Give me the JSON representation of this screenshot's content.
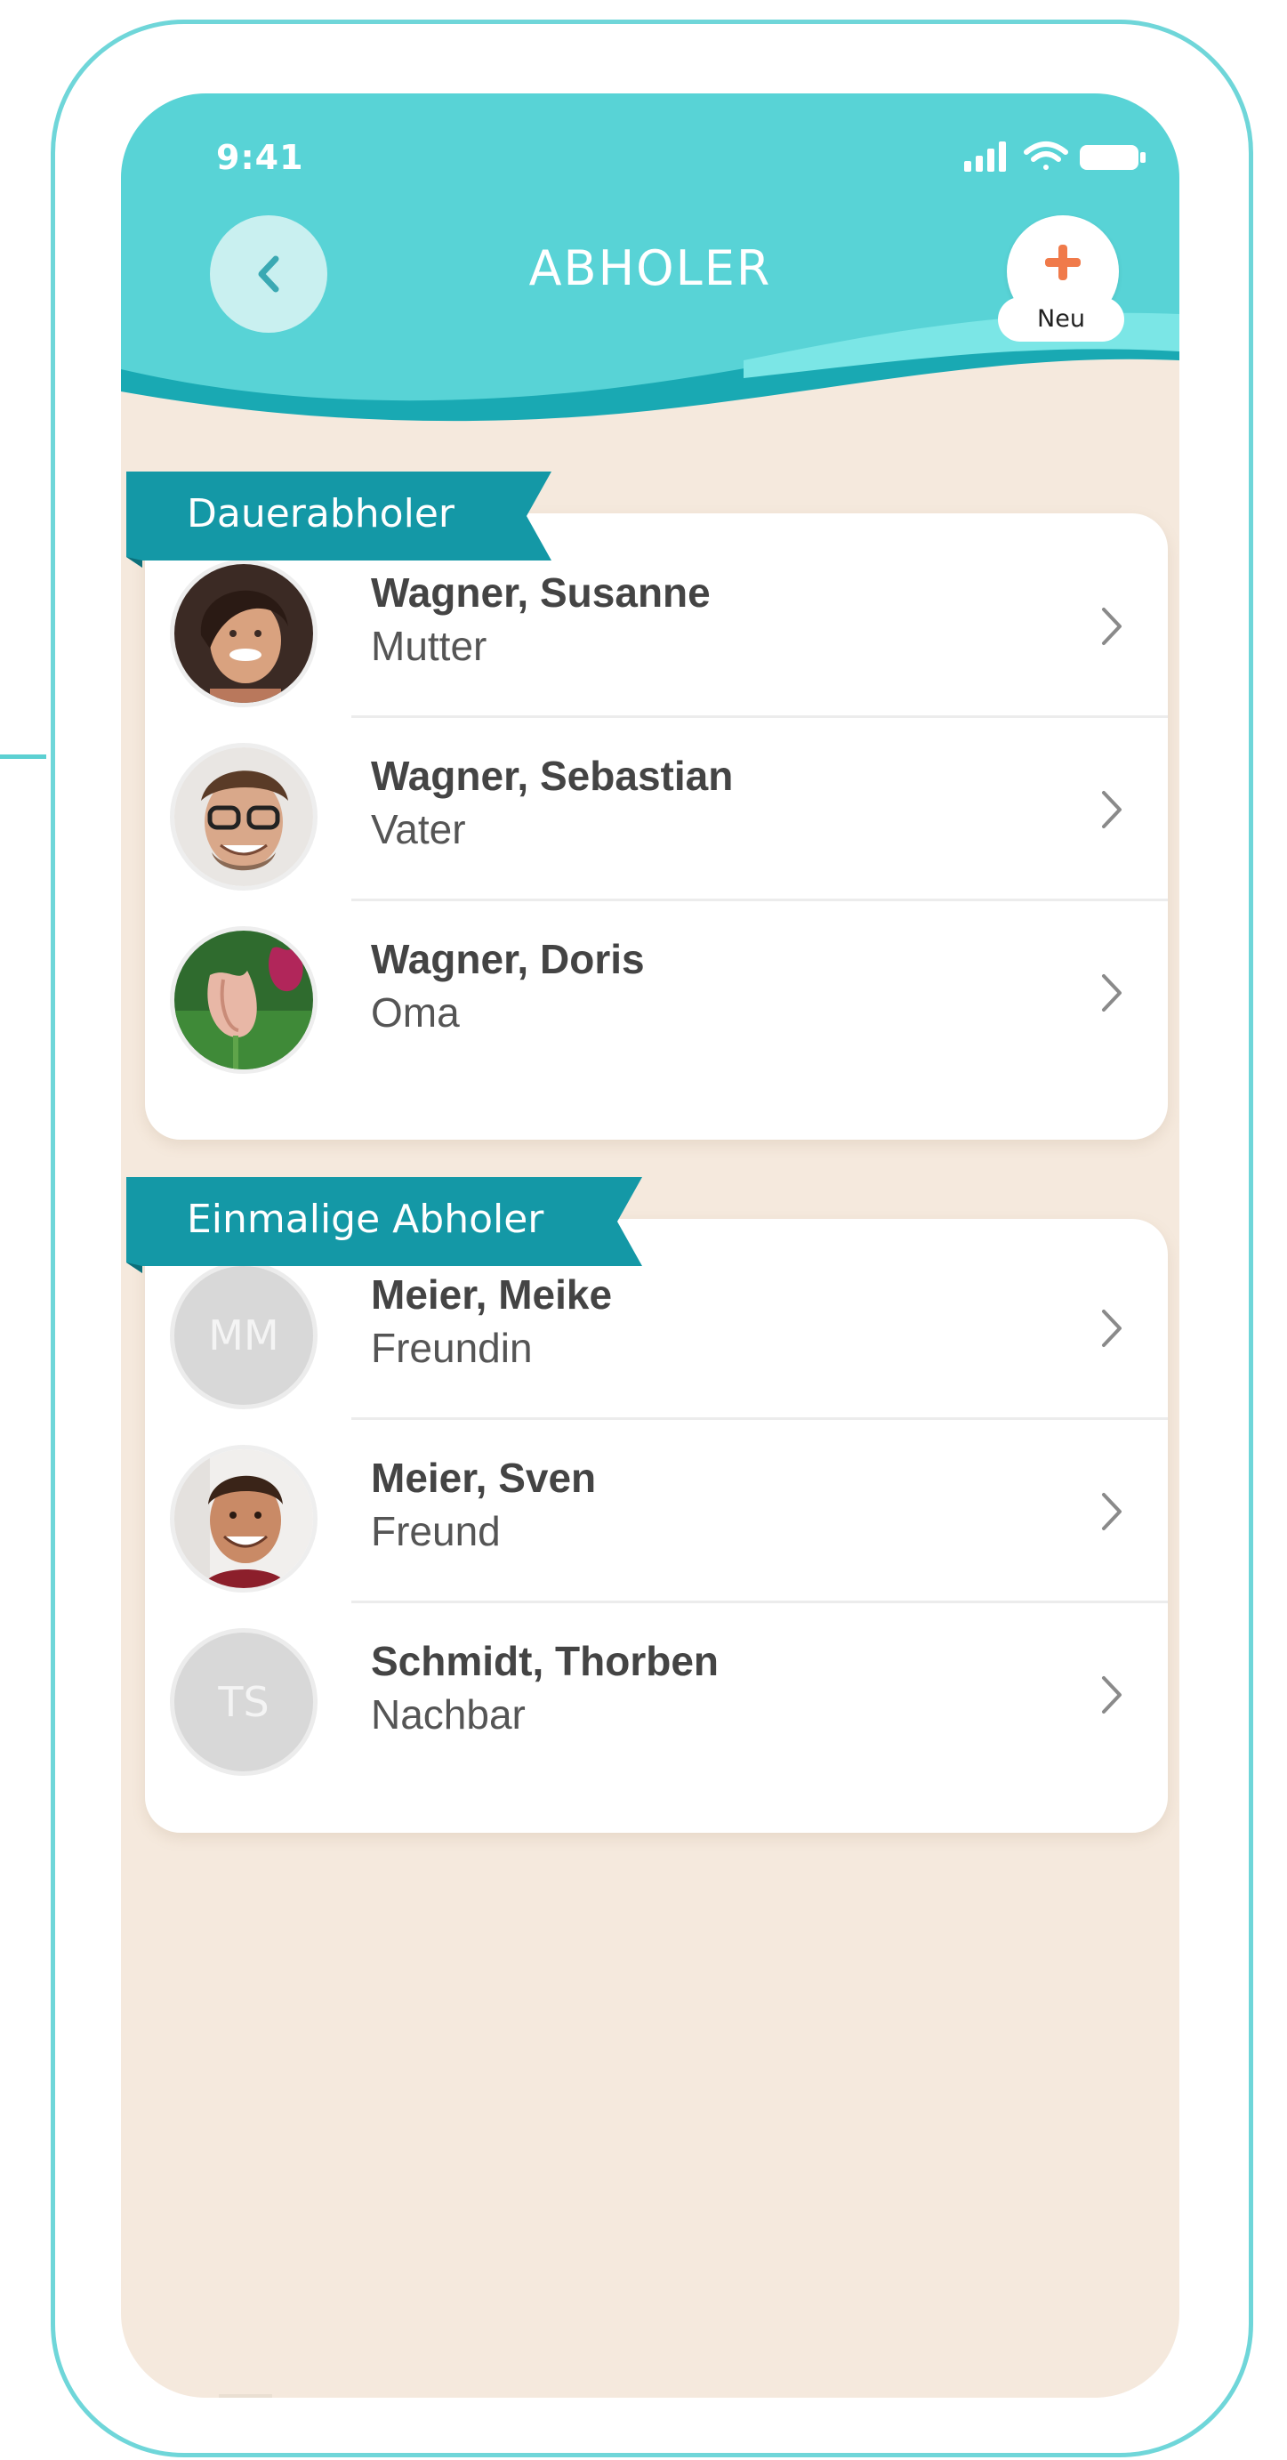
{
  "status_bar": {
    "time": "9:41"
  },
  "header": {
    "title": "ABHOLER",
    "back_icon": "chevron-left-icon",
    "new_icon": "plus-icon",
    "new_label": "Neu"
  },
  "sections": [
    {
      "title": "Dauerabholer",
      "items": [
        {
          "name": "Wagner, Susanne",
          "role": "Mutter",
          "avatar": "photo-woman"
        },
        {
          "name": "Wagner, Sebastian",
          "role": "Vater",
          "avatar": "photo-man-glasses"
        },
        {
          "name": "Wagner, Doris",
          "role": "Oma",
          "avatar": "photo-tulips"
        }
      ]
    },
    {
      "title": "Einmalige Abholer",
      "items": [
        {
          "name": "Meier, Meike",
          "role": "Freundin",
          "initials": "MM"
        },
        {
          "name": "Meier, Sven",
          "role": "Freund",
          "avatar": "photo-man-smiling"
        },
        {
          "name": "Schmidt, Thorben",
          "role": "Nachbar",
          "initials": "TS"
        }
      ]
    }
  ],
  "colors": {
    "accent": "#5ad5d7",
    "section_tab": "#1498a6",
    "background": "#f5e9dd",
    "plus": "#f07a4a"
  }
}
